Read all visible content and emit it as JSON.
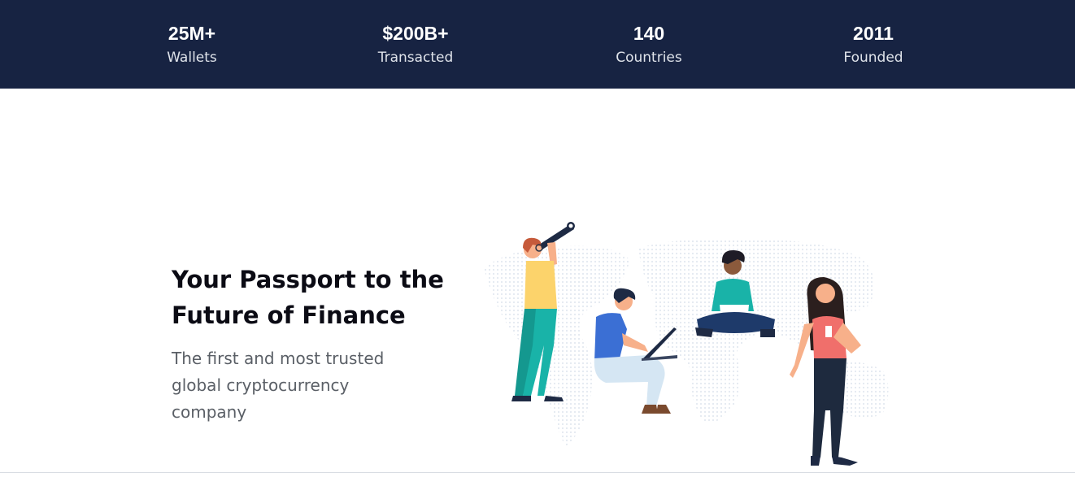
{
  "stats": [
    {
      "value": "25M+",
      "label": "Wallets"
    },
    {
      "value": "$200B+",
      "label": "Transacted"
    },
    {
      "value": "140",
      "label": "Countries"
    },
    {
      "value": "2011",
      "label": "Founded"
    }
  ],
  "hero": {
    "title_line1": "Your Passport to the",
    "title_line2": "Future of Finance",
    "subtitle_line1": "The first and most trusted",
    "subtitle_line2": "global cryptocurrency",
    "subtitle_line3": "company"
  },
  "colors": {
    "stats_background": "#172342",
    "title": "#0b0b14",
    "subtitle": "#5a5f66"
  },
  "illustration": {
    "icons": [
      "world-map-icon",
      "person-with-telescope-icon",
      "person-with-laptop-icon",
      "person-cross-legged-icon",
      "woman-with-phone-icon"
    ]
  }
}
